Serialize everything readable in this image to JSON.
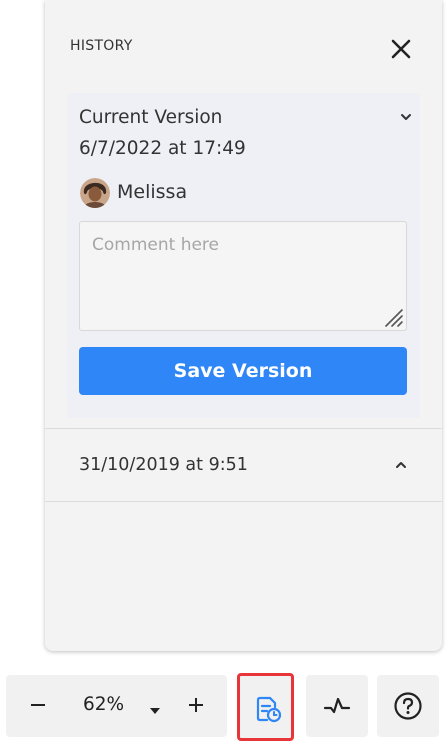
{
  "history_panel": {
    "title": "HISTORY",
    "close_icon": "close-icon",
    "current_version": {
      "title": "Current Version",
      "date": "6/7/2022 at 17:49",
      "user": "Melissa",
      "comment_placeholder": "Comment here",
      "comment_value": "",
      "save_label": "Save Version",
      "save_color": "#2f86f6",
      "expanded": true
    },
    "versions": [
      {
        "date": "31/10/2019 at 9:51",
        "expanded": false
      }
    ]
  },
  "toolbar": {
    "zoom_value": "62%",
    "zoom_out_icon": "minus-icon",
    "zoom_in_icon": "plus-icon",
    "zoom_dropdown_icon": "caret-down-icon",
    "history_icon": "version-history-icon",
    "activity_icon": "activity-icon",
    "help_icon": "help-icon",
    "active_highlight_color": "#e8353a"
  }
}
